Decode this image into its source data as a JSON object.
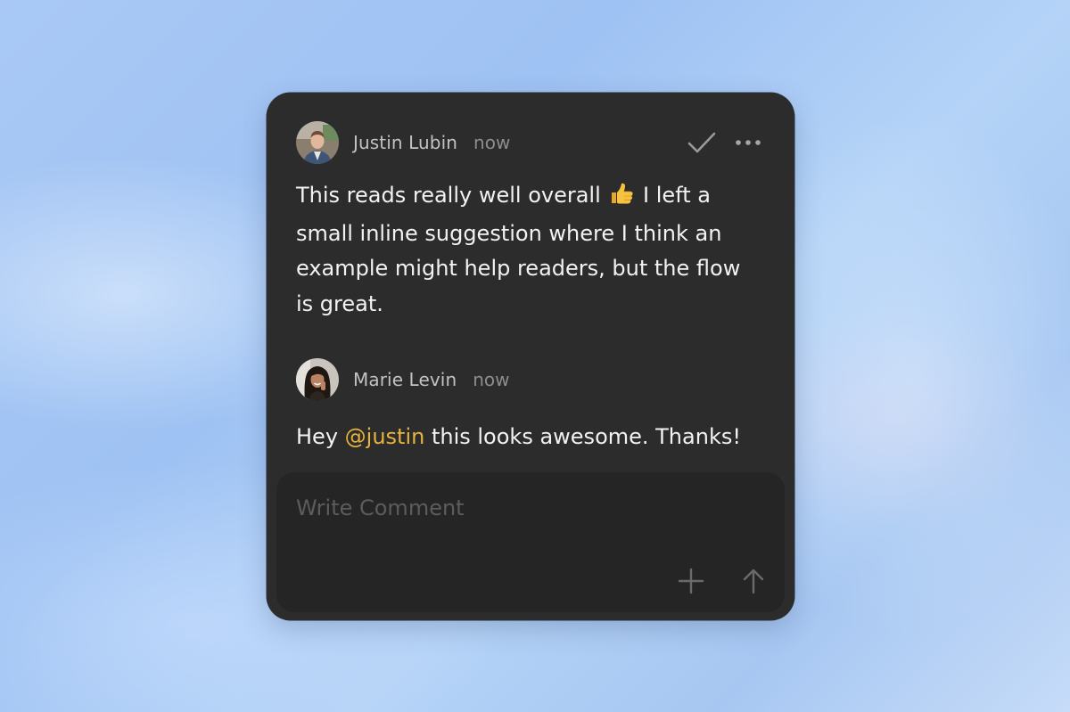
{
  "comments": [
    {
      "author": "Justin Lubin",
      "time": "now",
      "text_before_emoji": "This reads really well overall",
      "emoji_icon": "thumbs-up-emoji",
      "text_after_emoji": "I left a small inline suggestion where I think an example might help readers, but the flow is great."
    },
    {
      "author": "Marie Levin",
      "time": "now",
      "text_before_mention": "Hey",
      "mention": "@justin",
      "text_after_mention": "this looks awesome. Thanks!"
    }
  ],
  "actions": {
    "resolve_icon": "checkmark-icon",
    "more_icon": "more-horizontal-icon"
  },
  "composer": {
    "placeholder": "Write Comment",
    "value": "",
    "attach_icon": "plus-icon",
    "send_icon": "arrow-up-icon"
  },
  "colors": {
    "card_background": "#2c2c2c",
    "composer_background": "#252525",
    "mention": "#e8b23e",
    "body_text": "#f2f2f2",
    "author_text": "#c2c2c2",
    "muted_text": "#8d8d8d"
  }
}
